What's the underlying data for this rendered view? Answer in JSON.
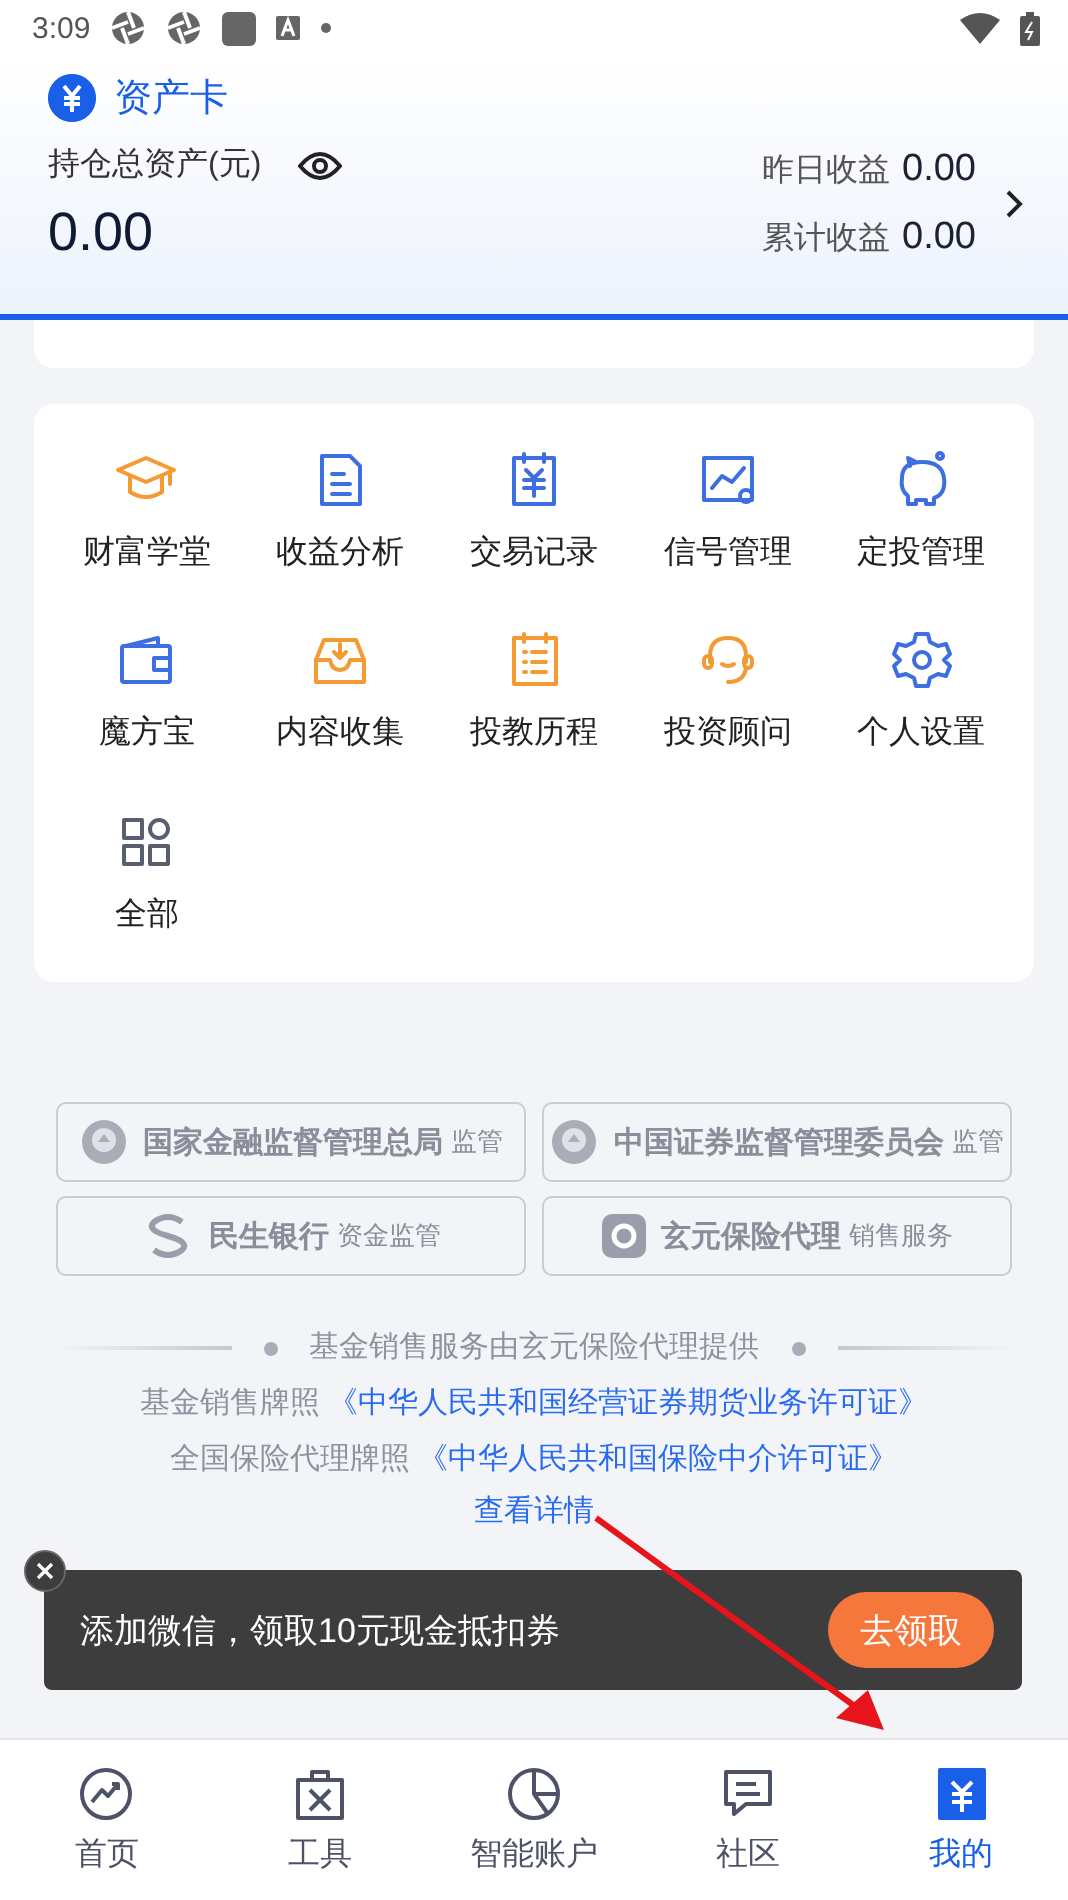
{
  "status_bar": {
    "time": "3:09"
  },
  "asset_card": {
    "title": "资产卡",
    "total_label": "持仓总资产(元)",
    "total_value": "0.00",
    "yesterday_label": "昨日收益",
    "yesterday_value": "0.00",
    "cumulative_label": "累计收益",
    "cumulative_value": "0.00"
  },
  "shortcuts": [
    {
      "label": "财富学堂",
      "kind": "cap",
      "color": "#f39a32"
    },
    {
      "label": "收益分析",
      "kind": "doc",
      "color": "#3d6fe2"
    },
    {
      "label": "交易记录",
      "kind": "ledger",
      "color": "#3d6fe2"
    },
    {
      "label": "信号管理",
      "kind": "chart",
      "color": "#3d6fe2"
    },
    {
      "label": "定投管理",
      "kind": "piggy",
      "color": "#3d6fe2"
    },
    {
      "label": "魔方宝",
      "kind": "wallet",
      "color": "#3d6fe2"
    },
    {
      "label": "内容收集",
      "kind": "inbox",
      "color": "#f39a32"
    },
    {
      "label": "投教历程",
      "kind": "list",
      "color": "#f39a32"
    },
    {
      "label": "投资顾问",
      "kind": "headset",
      "color": "#f39a32"
    },
    {
      "label": "个人设置",
      "kind": "gear",
      "color": "#3d6fe2"
    },
    {
      "label": "全部",
      "kind": "grid",
      "color": "#5a5f70"
    }
  ],
  "regulators": [
    {
      "name": "国家金融监督管理总局",
      "role": "监管",
      "kind": "emblem"
    },
    {
      "name": "中国证券监督管理委员会",
      "role": "监管",
      "kind": "emblem"
    },
    {
      "name": "民生银行",
      "role": "资金监管",
      "kind": "bank"
    },
    {
      "name": "玄元保险代理",
      "role": "销售服务",
      "kind": "agency"
    }
  ],
  "disclosure": {
    "provider": "基金销售服务由玄元保险代理提供",
    "licenses": [
      {
        "label": "基金销售牌照",
        "link": "《中华人民共和国经营证券期货业务许可证》"
      },
      {
        "label": "全国保险代理牌照",
        "link": "《中华人民共和国保险中介许可证》"
      }
    ],
    "details_link": "查看详情"
  },
  "toast": {
    "message": "添加微信，领取10元现金抵扣券",
    "button": "去领取"
  },
  "tab_bar": [
    {
      "label": "首页",
      "kind": "home",
      "selected": false
    },
    {
      "label": "工具",
      "kind": "tools",
      "selected": false
    },
    {
      "label": "智能账户",
      "kind": "pie",
      "selected": false
    },
    {
      "label": "社区",
      "kind": "chat",
      "selected": false
    },
    {
      "label": "我的",
      "kind": "mine",
      "selected": true
    }
  ]
}
